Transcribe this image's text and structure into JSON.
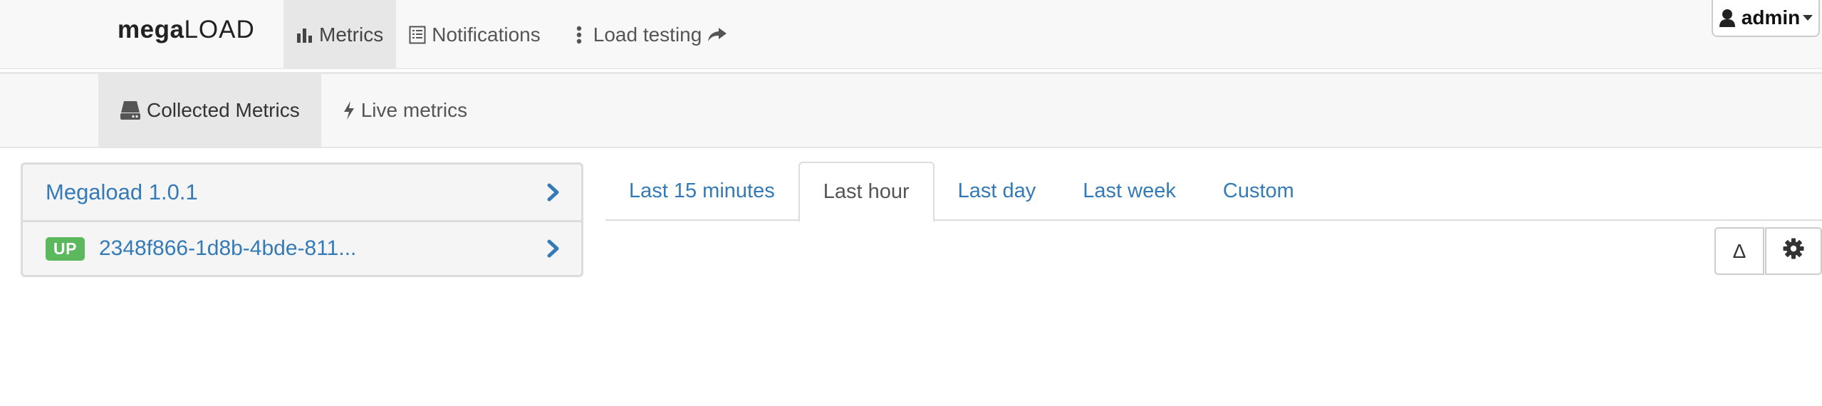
{
  "brand": {
    "bold": "mega",
    "light": "LOAD"
  },
  "nav": {
    "metrics": "Metrics",
    "notifications": "Notifications",
    "load_testing": "Load testing"
  },
  "user": {
    "name": "admin"
  },
  "subnav": {
    "collected": "Collected Metrics",
    "live": "Live metrics"
  },
  "panel": {
    "title": "Megaload 1.0.1",
    "instance": {
      "status": "UP",
      "id": "2348f866-1d8b-4bde-811..."
    }
  },
  "time_tabs": [
    "Last 15 minutes",
    "Last hour",
    "Last day",
    "Last week",
    "Custom"
  ],
  "active_tab": "Last hour",
  "tools": {
    "delta": "Δ"
  },
  "colors": {
    "link": "#337ab7",
    "up_badge": "#5cb85c",
    "navbar_bg": "#f8f8f8",
    "active_bg": "#e7e7e7"
  },
  "icons": [
    "bar-chart-icon",
    "list-icon",
    "vertical-dots-icon",
    "share-arrow-icon",
    "user-icon",
    "hdd-icon",
    "bolt-icon",
    "chevron-right-icon",
    "gear-icon"
  ]
}
